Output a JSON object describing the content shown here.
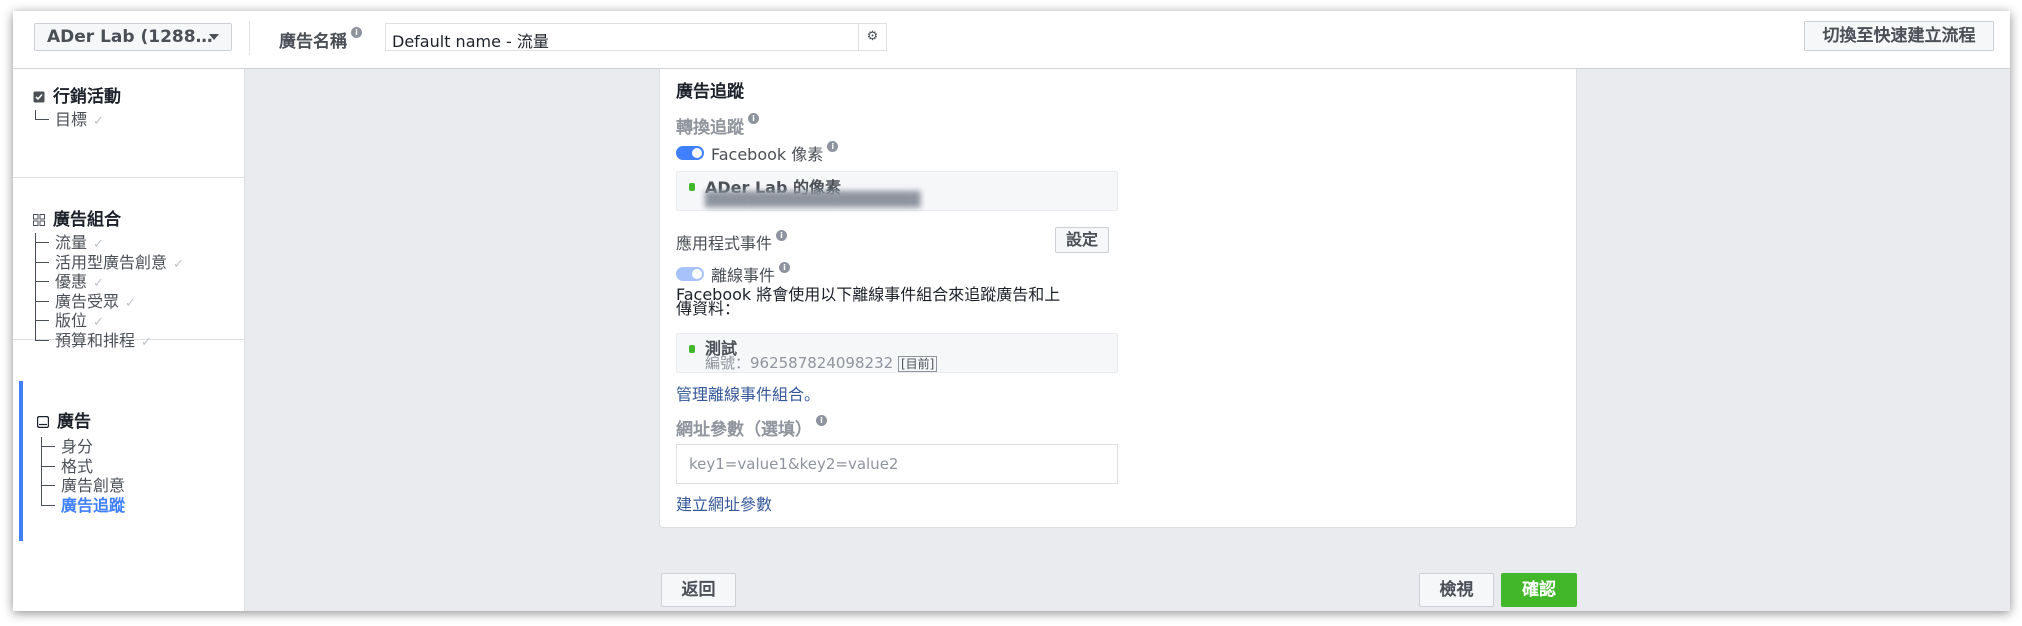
{
  "topbar": {
    "account_select": "ADer Lab (1288…",
    "ad_name_label": "廣告名稱",
    "ad_name_value": "Default name - 流量",
    "switch_button": "切換至快速建立流程"
  },
  "sidebar": {
    "campaign": {
      "title": "行銷活動",
      "items": [
        "目標"
      ]
    },
    "adset": {
      "title": "廣告組合",
      "items": [
        "流量",
        "活用型廣告創意",
        "優惠",
        "廣告受眾",
        "版位",
        "預算和排程"
      ]
    },
    "ad": {
      "title": "廣告",
      "items": [
        "身分",
        "格式",
        "廣告創意",
        "廣告追蹤"
      ],
      "active_item": "廣告追蹤"
    }
  },
  "card": {
    "heading": "廣告追蹤",
    "conversion_label": "轉換追蹤",
    "pixel_toggle_label": "Facebook 像素",
    "pixel_name": "ADer Lab 的像素",
    "app_events_label": "應用程式事件",
    "settings_button": "設定",
    "offline_toggle_label": "離線事件",
    "offline_desc_line1": "Facebook 將會使用以下離線事件組合來追蹤廣告和上",
    "offline_desc_line2": "傳資料：",
    "event_set_name": "測試",
    "event_set_id": "編號：962587824098232",
    "event_set_tag": "[目前]",
    "manage_link": "管理離線事件組合。",
    "url_params_label": "網址參數（選填）",
    "url_params_placeholder": "key1=value1&key2=value2",
    "build_url_link": "建立網址參數"
  },
  "footer": {
    "back_button": "返回",
    "review_button": "檢視",
    "confirm_button": "確認"
  },
  "colors": {
    "accent": "#4080ff",
    "link": "#365899",
    "confirm": "#42b72a",
    "background": "#e9ebee"
  }
}
